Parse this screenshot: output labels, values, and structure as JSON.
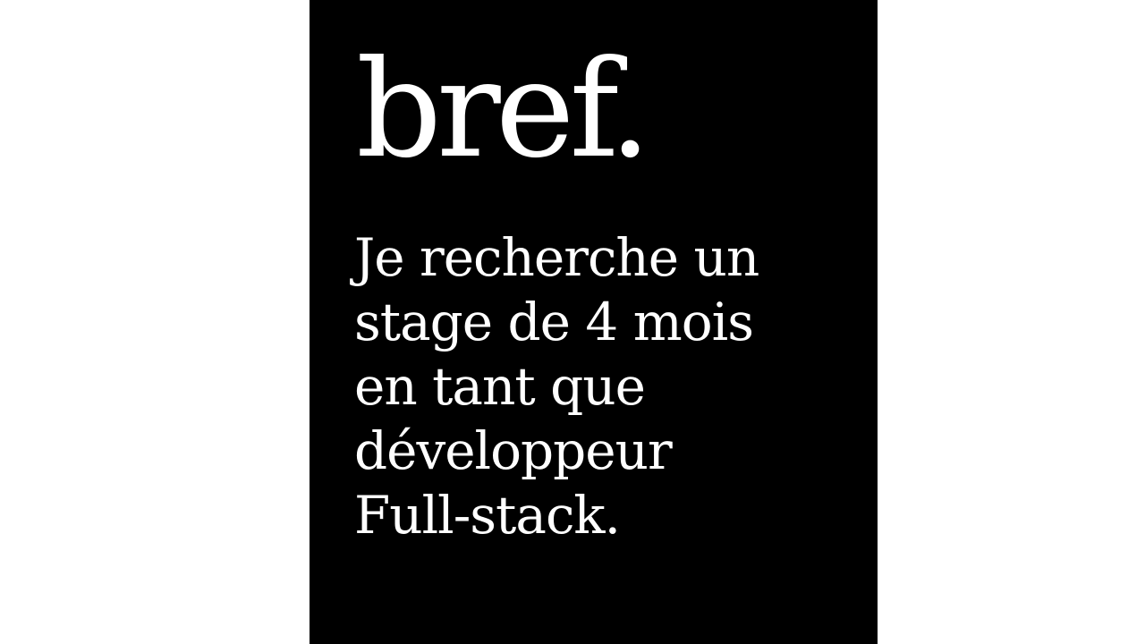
{
  "card": {
    "title": "bref.",
    "lines": [
      "Je recherche un",
      "stage de 4 mois",
      "en tant que",
      "développeur",
      "Full-stack."
    ]
  }
}
